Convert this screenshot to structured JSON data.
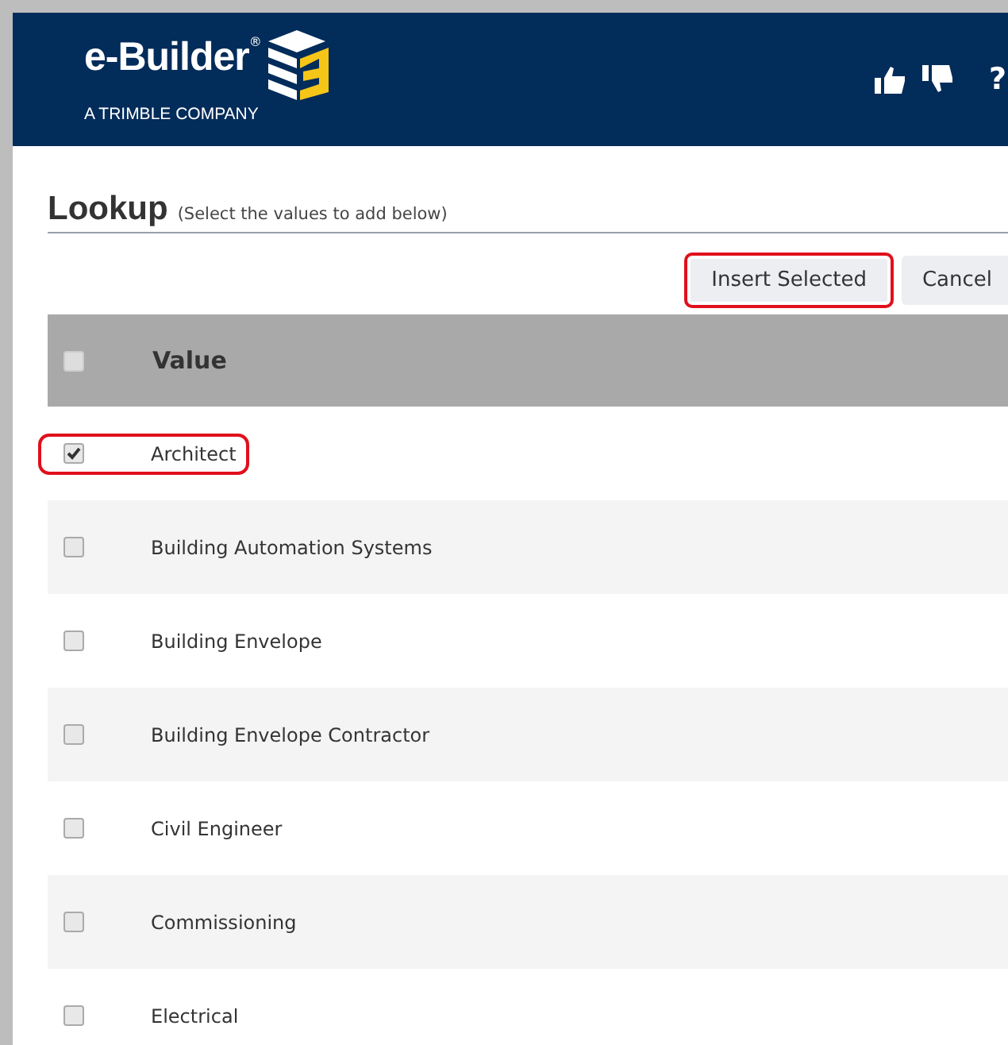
{
  "header": {
    "logo_text": "e-Builder",
    "logo_mark": "®",
    "tagline": "A TRIMBLE COMPANY",
    "help": "?"
  },
  "lookup": {
    "title": "Lookup",
    "hint": "(Select the values to add below)"
  },
  "buttons": [
    {
      "label": "Insert Selected",
      "highlighted": true
    },
    {
      "label": "Cancel",
      "highlighted": false
    }
  ],
  "table": {
    "header_checked": false,
    "column": "Value",
    "rows": [
      {
        "value": "Architect",
        "checked": true,
        "highlighted": true
      },
      {
        "value": "Building Automation Systems",
        "checked": false,
        "highlighted": false
      },
      {
        "value": "Building Envelope",
        "checked": false,
        "highlighted": false
      },
      {
        "value": "Building Envelope Contractor",
        "checked": false,
        "highlighted": false
      },
      {
        "value": "Civil Engineer",
        "checked": false,
        "highlighted": false
      },
      {
        "value": "Commissioning",
        "checked": false,
        "highlighted": false
      },
      {
        "value": "Electrical",
        "checked": false,
        "highlighted": false
      }
    ]
  }
}
